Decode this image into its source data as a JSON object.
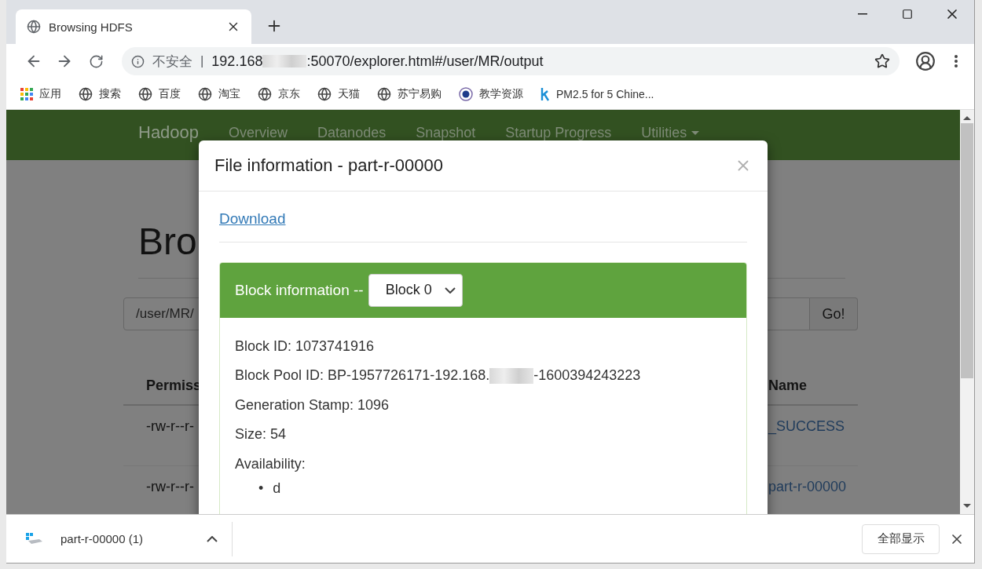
{
  "browser": {
    "tab": {
      "title": "Browsing HDFS"
    },
    "security_label": "不安全",
    "security_separator": "|",
    "url_start": "192.168",
    "url_end": ":50070/explorer.html#/user/MR/output",
    "bookmarks": [
      {
        "label": "应用",
        "kind": "apps"
      },
      {
        "label": "搜索",
        "kind": "site"
      },
      {
        "label": "百度",
        "kind": "site"
      },
      {
        "label": "淘宝",
        "kind": "site"
      },
      {
        "label": "京东",
        "kind": "site"
      },
      {
        "label": "天猫",
        "kind": "site"
      },
      {
        "label": "苏宁易购",
        "kind": "site"
      },
      {
        "label": "教学资源",
        "kind": "emblem"
      },
      {
        "label": "PM2.5 for 5 Chine...",
        "kind": "letter"
      }
    ]
  },
  "page": {
    "navbar": {
      "brand": "Hadoop",
      "items": [
        {
          "label": "Overview",
          "dropdown": false
        },
        {
          "label": "Datanodes",
          "dropdown": false
        },
        {
          "label": "Snapshot",
          "dropdown": false
        },
        {
          "label": "Startup Progress",
          "dropdown": false
        },
        {
          "label": "Utilities",
          "dropdown": true
        }
      ]
    },
    "heading": "Bro",
    "path_input": "/user/MR/",
    "go_button": "Go!",
    "table": {
      "column_1": "Permiss",
      "column_2": "Name",
      "rows": [
        {
          "column_1": "-rw-r--r-",
          "column_2": "_SUCCESS"
        },
        {
          "column_1": "-rw-r--r-",
          "column_2": "part-r-00000"
        }
      ]
    }
  },
  "modal": {
    "title": "File information - part-r-00000",
    "download_link": "Download",
    "block_heading": "Block information --",
    "block_select": "Block 0",
    "fields": [
      {
        "text": "Block ID: 1073741916"
      },
      {
        "text": "Block Pool ID: BP-1957726171-192.168.",
        "text_after": "-1600394243223"
      },
      {
        "text": "Generation Stamp: 1096"
      },
      {
        "text": "Size: 54"
      },
      {
        "text": "Availability:"
      }
    ],
    "availability": [
      {
        "marker": "•",
        "text": "d"
      }
    ]
  },
  "download_shelf": {
    "file": "part-r-00000 (1)",
    "show_all": "全部显示"
  }
}
